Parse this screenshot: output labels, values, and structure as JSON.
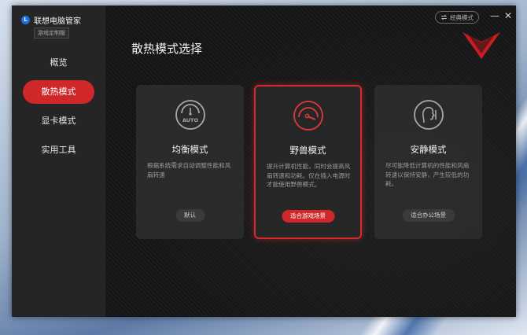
{
  "app": {
    "title": "联想电脑管家",
    "edition": "游戏定制版",
    "logo_letter": "L"
  },
  "sidebar": {
    "items": [
      {
        "label": "概览",
        "active": false
      },
      {
        "label": "散热模式",
        "active": true
      },
      {
        "label": "显卡模式",
        "active": false
      },
      {
        "label": "实用工具",
        "active": false
      }
    ]
  },
  "header": {
    "classic_mode_label": "经典模式",
    "minimize_glyph": "—",
    "close_glyph": "✕"
  },
  "main": {
    "title": "散热模式选择",
    "cards": [
      {
        "title": "均衡模式",
        "icon": "auto-gauge-icon",
        "icon_text": "AUTO",
        "description": "根据系统需求自动调整性能和风扇转速",
        "tag": "默认",
        "selected": false
      },
      {
        "title": "野兽模式",
        "icon": "performance-gauge-icon",
        "description": "提升计算机性能，同时会提高风扇转速和功耗。仅在插入电源时才能使用野兽模式。",
        "tag": "适合游戏场景",
        "selected": true
      },
      {
        "title": "安静模式",
        "icon": "quiet-hush-icon",
        "description": "尽可能降低计算机的性能和风扇转速以保持安静，产生较低的功耗。",
        "tag": "适合办公场景",
        "selected": false
      }
    ]
  },
  "colors": {
    "accent": "#d0282a",
    "sidebar_bg": "#252525",
    "main_bg": "#141414",
    "card_bg": "#2e2e2e",
    "logo_blue": "#1c6fe0"
  }
}
